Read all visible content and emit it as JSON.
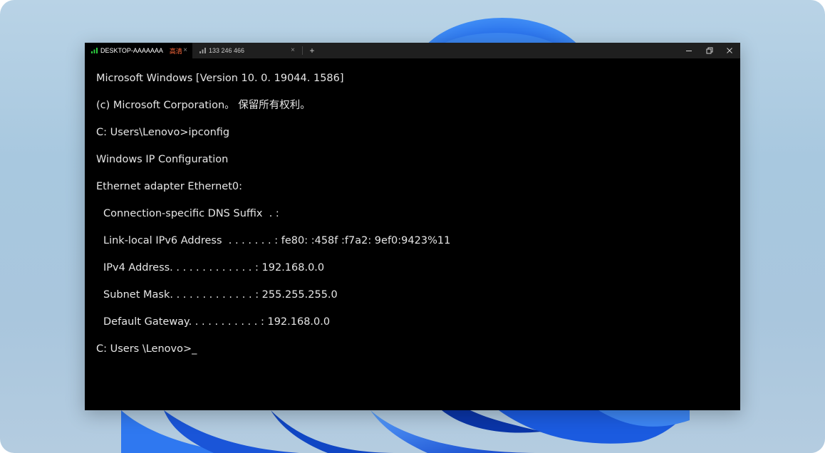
{
  "tabs": [
    {
      "label": "DESKTOP-AAAAAAA",
      "badge": "高清",
      "signal_color": "#2ecc40"
    },
    {
      "label": "133 246 466"
    }
  ],
  "tab_close_glyph": "×",
  "new_tab_glyph": "+",
  "window_controls": [
    "minimize-icon",
    "restore-icon",
    "close-icon"
  ],
  "console": {
    "lines": [
      {
        "text": "Microsoft Windows [Version 10. 0. 19044. 1586]"
      },
      {
        "text": "(c) Microsoft Corporation。 保留所有权利。"
      },
      {
        "text": "C: Users\\Lenovo>ipconfig"
      },
      {
        "text": "Windows IP Configuration"
      },
      {
        "text": "Ethernet adapter Ethernet0:"
      },
      {
        "text": "Connection-specific DNS Suffix  . :",
        "indent": true
      },
      {
        "text": "Link-local IPv6 Address  . . . . . . . : fe80: :458f :f7a2: 9ef0:9423%11",
        "indent": true
      },
      {
        "text": "IPv4 Address. . . . . . . . . . . . . : 192.168.0.0",
        "indent": true
      },
      {
        "text": "Subnet Mask. . . . . . . . . . . . . : 255.255.255.0",
        "indent": true
      },
      {
        "text": "Default Gateway. . . . . . . . . . . : 192.168.0.0",
        "indent": true
      },
      {
        "text": "C: Users \\Lenovo>_"
      }
    ]
  },
  "colors": {
    "terminal_bg": "#000000",
    "titlebar_bg": "#1f1f1f",
    "text": "#e6e6e6",
    "badge": "#ff6a3d",
    "wallpaper_blue": "#1d63e0"
  }
}
